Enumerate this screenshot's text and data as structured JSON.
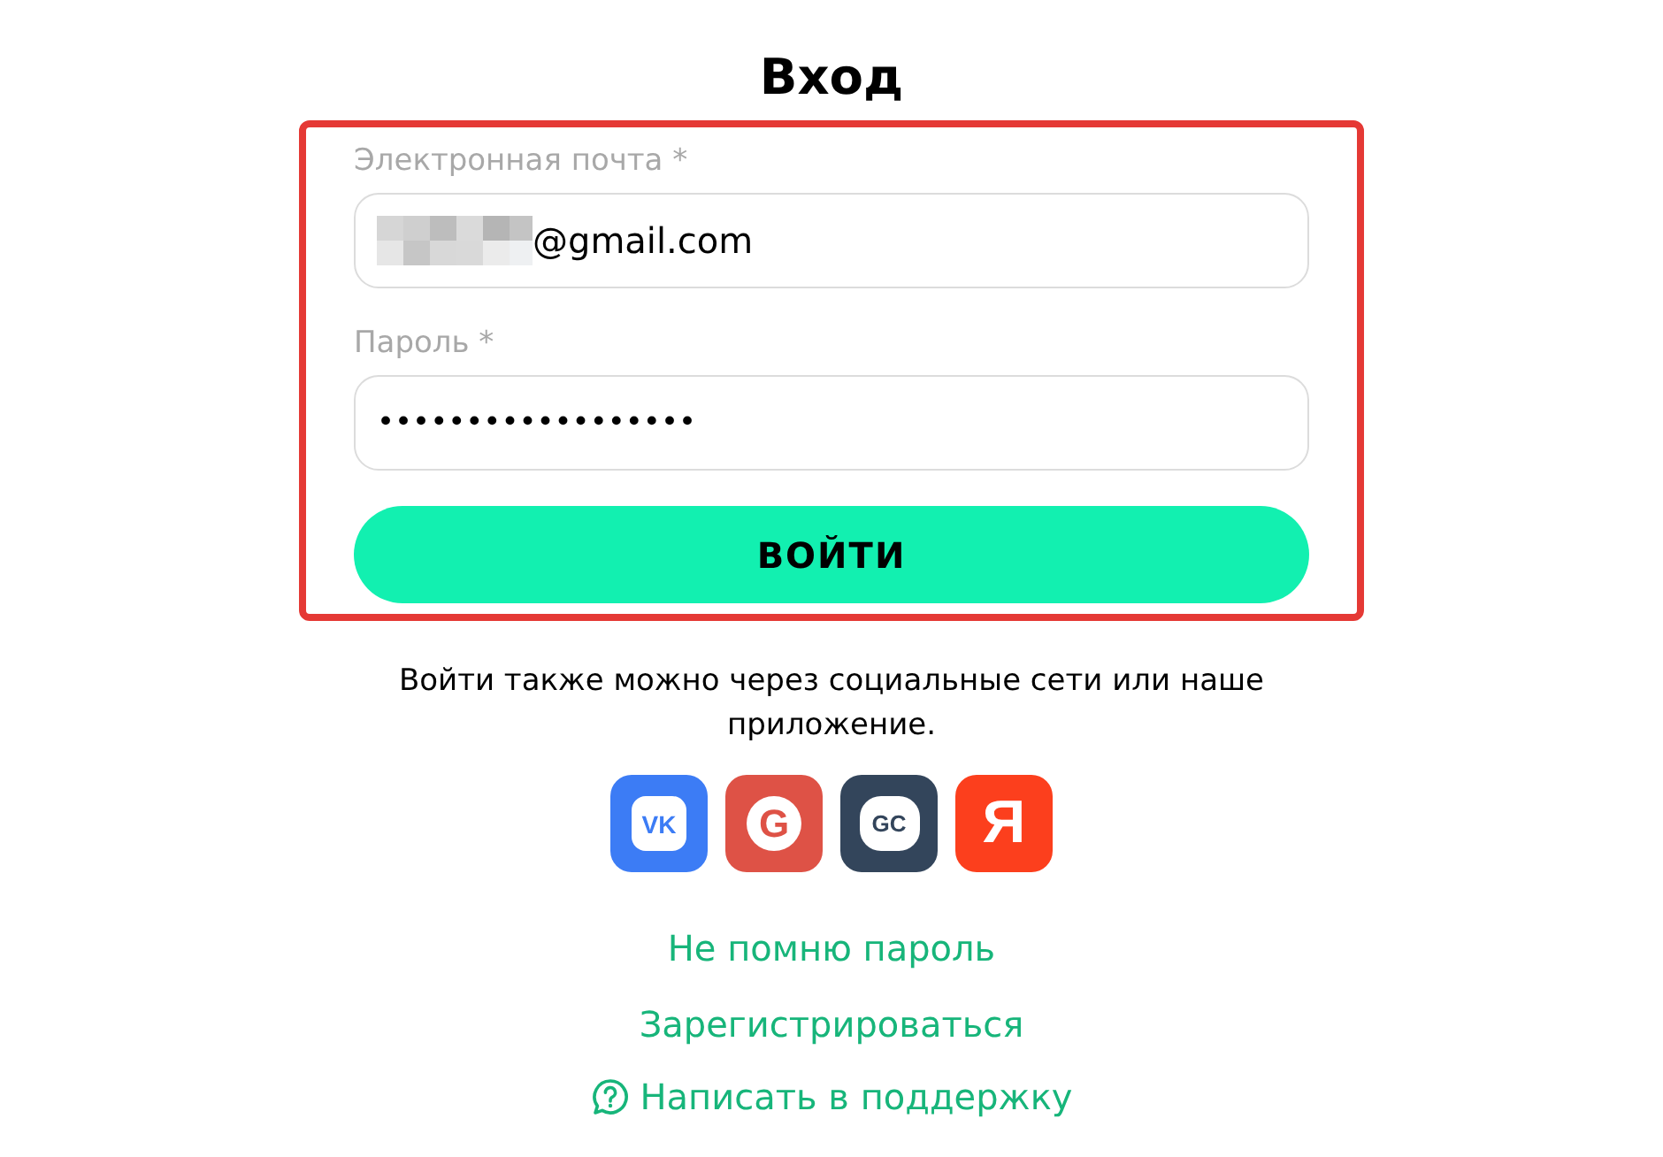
{
  "title": "Вход",
  "form": {
    "fields": [
      {
        "kind": "email",
        "label": "Электронная почта *",
        "value": "@gmail.com"
      },
      {
        "kind": "password",
        "label": "Пароль *",
        "value": "••••••••••••••••••"
      }
    ],
    "submit": "ВОЙТИ"
  },
  "social_text": "Войти также можно через социальные сети или наше приложение.",
  "social": [
    {
      "label": "VK",
      "color": "#3c7cf5"
    },
    {
      "label": "G",
      "color": "#de5246"
    },
    {
      "label": "GC",
      "color": "#33455b"
    },
    {
      "label": "Я",
      "color": "#fc3f1d"
    }
  ],
  "links": [
    {
      "kind": "plain",
      "text": "Не помню пароль"
    },
    {
      "kind": "plain",
      "text": "Зарегистрироваться"
    },
    {
      "kind": "support",
      "text": "Написать в поддержку"
    }
  ]
}
